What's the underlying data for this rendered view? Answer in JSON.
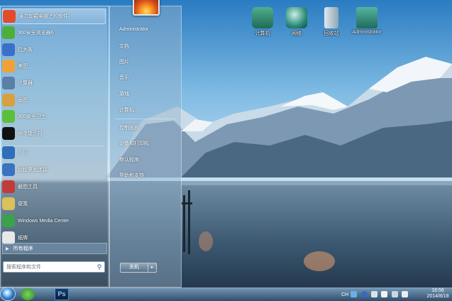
{
  "desktop": {
    "icons": [
      {
        "label": "计算机",
        "icon": "computer-icon"
      },
      {
        "label": "网络",
        "icon": "network-icon"
      },
      {
        "label": "回收站",
        "icon": "recycle-bin-icon"
      },
      {
        "label": "Administrator",
        "icon": "user-folder-icon"
      }
    ]
  },
  "start_menu": {
    "programs": [
      {
        "label": "强力卸载电脑上的软件",
        "icon": "uninstall-icon",
        "color": "#e24b2b"
      },
      {
        "label": "360安全浏览器6",
        "icon": "browser-360-icon",
        "color": "#4caf3a"
      },
      {
        "label": "拉大客",
        "icon": "app-icon",
        "color": "#3b6fc8"
      },
      {
        "label": "美图",
        "icon": "meitu-icon",
        "color": "#f0a23a"
      },
      {
        "label": "计算器",
        "icon": "calculator-icon",
        "color": "#5a7fa8"
      },
      {
        "label": "画图",
        "icon": "paint-icon",
        "color": "#d8a040"
      },
      {
        "label": "360安全卫士",
        "icon": "shield-360-icon",
        "color": "#5cbf3a"
      },
      {
        "label": "命令提示符",
        "icon": "cmd-icon",
        "color": "#111111"
      },
      {
        "label": "入门",
        "icon": "getting-started-icon",
        "color": "#2d6fb8"
      },
      {
        "label": "远程桌面连接",
        "icon": "remote-desktop-icon",
        "color": "#3a74c0"
      },
      {
        "label": "截图工具",
        "icon": "snipping-tool-icon",
        "color": "#c23b3b"
      },
      {
        "label": "便笺",
        "icon": "sticky-notes-icon",
        "color": "#d9c25a"
      },
      {
        "label": "Windows Media Center",
        "icon": "media-center-icon",
        "color": "#3aa24a"
      },
      {
        "label": "纸牌",
        "icon": "solitaire-icon",
        "color": "#e8e8e8"
      }
    ],
    "all_programs_label": "所有程序",
    "search_placeholder": "搜索程序和文件",
    "right_items": [
      {
        "label": "Administrator"
      },
      {
        "label": "文档"
      },
      {
        "label": "图片"
      },
      {
        "label": "音乐"
      },
      {
        "label": "游戏"
      },
      {
        "label": "计算机"
      },
      {
        "label": "控制面板"
      },
      {
        "label": "设备和打印机"
      },
      {
        "label": "默认程序"
      },
      {
        "label": "帮助和支持"
      }
    ],
    "shutdown_label": "关机",
    "shutdown_arrow": "▸"
  },
  "taskbar": {
    "ps_label": "Ps",
    "input_method": "CH",
    "time": "16:56",
    "date": "2014/8/18"
  }
}
